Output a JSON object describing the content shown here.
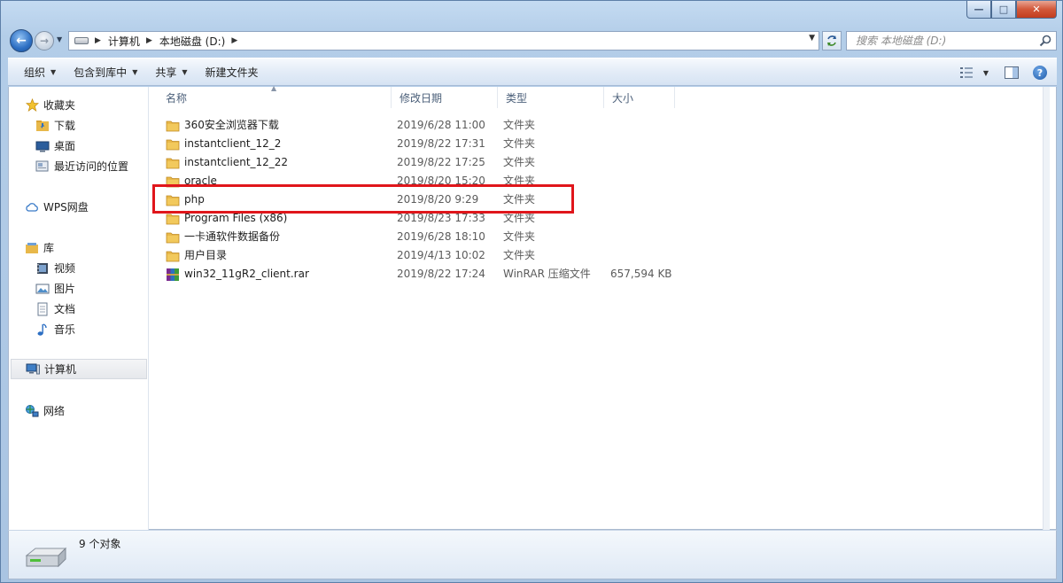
{
  "window": {
    "minimize_label": "—",
    "maximize_label": "□",
    "close_label": "✕"
  },
  "nav": {
    "back_label": "←",
    "forward_label": "→",
    "breadcrumbs": [
      "计算机",
      "本地磁盘 (D:)"
    ],
    "search_placeholder": "搜索 本地磁盘 (D:)"
  },
  "toolbar": {
    "items": [
      "组织",
      "包含到库中",
      "共享",
      "新建文件夹"
    ]
  },
  "sidebar": {
    "favorites": {
      "label": "收藏夹",
      "items": [
        "下载",
        "桌面",
        "最近访问的位置"
      ]
    },
    "wps": {
      "label": "WPS网盘"
    },
    "libraries": {
      "label": "库",
      "items": [
        "视频",
        "图片",
        "文档",
        "音乐"
      ]
    },
    "computer": {
      "label": "计算机"
    },
    "network": {
      "label": "网络"
    }
  },
  "columns": {
    "name": "名称",
    "date": "修改日期",
    "type": "类型",
    "size": "大小"
  },
  "files": [
    {
      "name": "360安全浏览器下载",
      "date": "2019/6/28 11:00",
      "type": "文件夹",
      "size": ""
    },
    {
      "name": "instantclient_12_2",
      "date": "2019/8/22 17:31",
      "type": "文件夹",
      "size": ""
    },
    {
      "name": "instantclient_12_22",
      "date": "2019/8/22 17:25",
      "type": "文件夹",
      "size": ""
    },
    {
      "name": "oracle",
      "date": "2019/8/20 15:20",
      "type": "文件夹",
      "size": ""
    },
    {
      "name": "php",
      "date": "2019/8/20 9:29",
      "type": "文件夹",
      "size": ""
    },
    {
      "name": "Program Files (x86)",
      "date": "2019/8/23 17:33",
      "type": "文件夹",
      "size": ""
    },
    {
      "name": "一卡通软件数据备份",
      "date": "2019/6/28 18:10",
      "type": "文件夹",
      "size": ""
    },
    {
      "name": "用户目录",
      "date": "2019/4/13 10:02",
      "type": "文件夹",
      "size": ""
    },
    {
      "name": "win32_11gR2_client.rar",
      "date": "2019/8/22 17:24",
      "type": "WinRAR 压缩文件",
      "size": "657,594 KB"
    }
  ],
  "status": {
    "count": "9 个对象"
  },
  "colors": {
    "highlight": "#e0161b",
    "folder": "#e8b84a",
    "accent": "#2d6fc3"
  }
}
